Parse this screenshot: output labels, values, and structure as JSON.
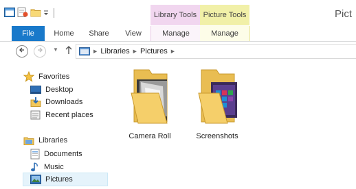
{
  "window": {
    "title": "Pict"
  },
  "context_tabs": {
    "library_tools": "Library Tools",
    "picture_tools": "Picture Tools"
  },
  "ribbon": {
    "file": "File",
    "home": "Home",
    "share": "Share",
    "view": "View",
    "manage_library": "Manage",
    "manage_picture": "Manage"
  },
  "address": {
    "crumbs": [
      "Libraries",
      "Pictures"
    ]
  },
  "nav": {
    "favorites": "Favorites",
    "desktop": "Desktop",
    "downloads": "Downloads",
    "recent": "Recent places",
    "libraries": "Libraries",
    "documents": "Documents",
    "music": "Music",
    "pictures": "Pictures"
  },
  "items": [
    {
      "name": "Camera Roll"
    },
    {
      "name": "Screenshots"
    }
  ],
  "colors": {
    "accent": "#1979ca",
    "library_tools": "#f1d6ef",
    "picture_tools": "#f1f0a8",
    "selection": "#e5f3fb"
  }
}
